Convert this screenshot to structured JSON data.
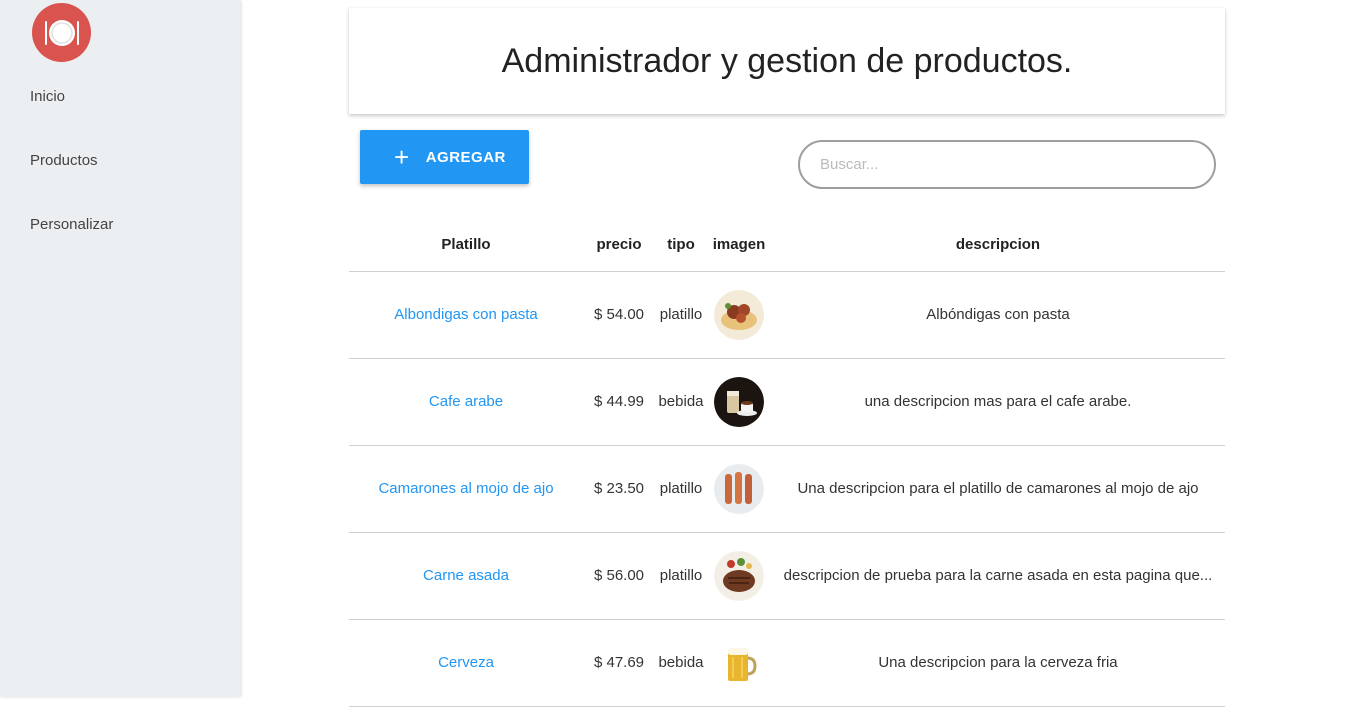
{
  "sidebar": {
    "logo_icon": "plate-cutlery-icon",
    "items": [
      {
        "label": "Inicio"
      },
      {
        "label": "Productos"
      },
      {
        "label": "Personalizar"
      }
    ]
  },
  "header": {
    "title": "Administrador y gestion de productos."
  },
  "toolbar": {
    "add_icon": "plus-icon",
    "add_label": "AGREGAR",
    "search_placeholder": "Buscar..."
  },
  "table": {
    "columns": [
      "Platillo",
      "precio",
      "tipo",
      "imagen",
      "descripcion"
    ],
    "rows": [
      {
        "name": "Albondigas con pasta",
        "price": "$ 54.00",
        "type": "platillo",
        "image": "meatballs-pasta-image",
        "description": "Albóndigas con pasta"
      },
      {
        "name": "Cafe arabe",
        "price": "$ 44.99",
        "type": "bebida",
        "image": "arabic-coffee-image",
        "description": "una descripcion mas para el cafe arabe."
      },
      {
        "name": "Camarones al mojo de ajo",
        "price": "$ 23.50",
        "type": "platillo",
        "image": "garlic-shrimp-image",
        "description": "Una descripcion para el platillo de camarones al mojo de ajo"
      },
      {
        "name": "Carne asada",
        "price": "$ 56.00",
        "type": "platillo",
        "image": "grilled-beef-image",
        "description": "descripcion de prueba para la carne asada en esta pagina que..."
      },
      {
        "name": "Cerveza",
        "price": "$ 47.69",
        "type": "bebida",
        "image": "beer-mug-image",
        "description": "Una descripcion para la cerveza fria"
      }
    ]
  },
  "colors": {
    "accent": "#2196f3",
    "logo": "#d9534f",
    "sidebar_bg": "#eceff1"
  }
}
